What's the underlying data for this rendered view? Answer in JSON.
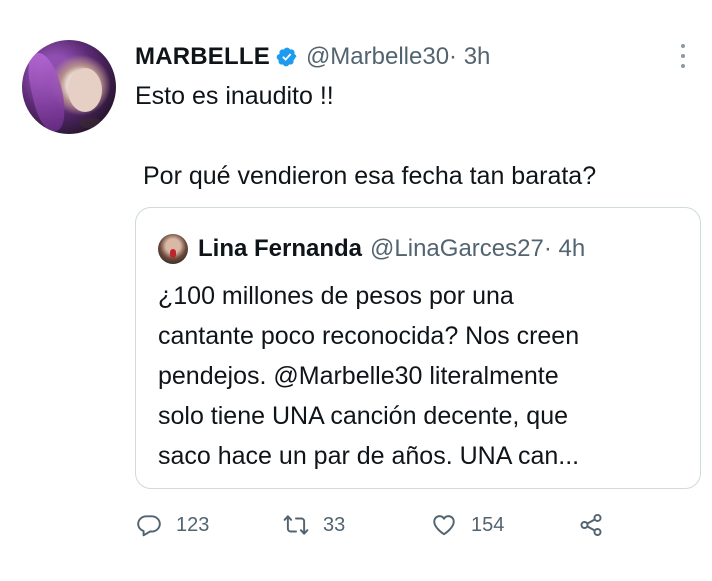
{
  "tweet": {
    "author_name": "MARBELLE",
    "handle": "@Marbelle30",
    "time": " · 3h",
    "text_line1": "Esto es inaudito !!",
    "text_line2": "Por qué vendieron esa fecha tan barata?"
  },
  "quoted": {
    "author_name": "Lina Fernanda",
    "handle": "@LinaGarces27",
    "time": " · 4h",
    "text": "¿100 millones de pesos por una\ncantante poco reconocida? Nos creen\npendejos. @Marbelle30 literalmente\nsolo tiene UNA canción decente, que\nsaco hace un par de años. UNA can..."
  },
  "actions": {
    "replies": "123",
    "retweets": "33",
    "likes": "154"
  },
  "icons": {
    "verified": "verified-badge-icon",
    "more": "more-options-icon",
    "reply": "reply-icon",
    "retweet": "retweet-icon",
    "like": "like-icon",
    "share": "share-icon"
  },
  "colors": {
    "verified_blue": "#1d9bf0",
    "secondary_text": "#536471",
    "border": "#cfd9de"
  }
}
